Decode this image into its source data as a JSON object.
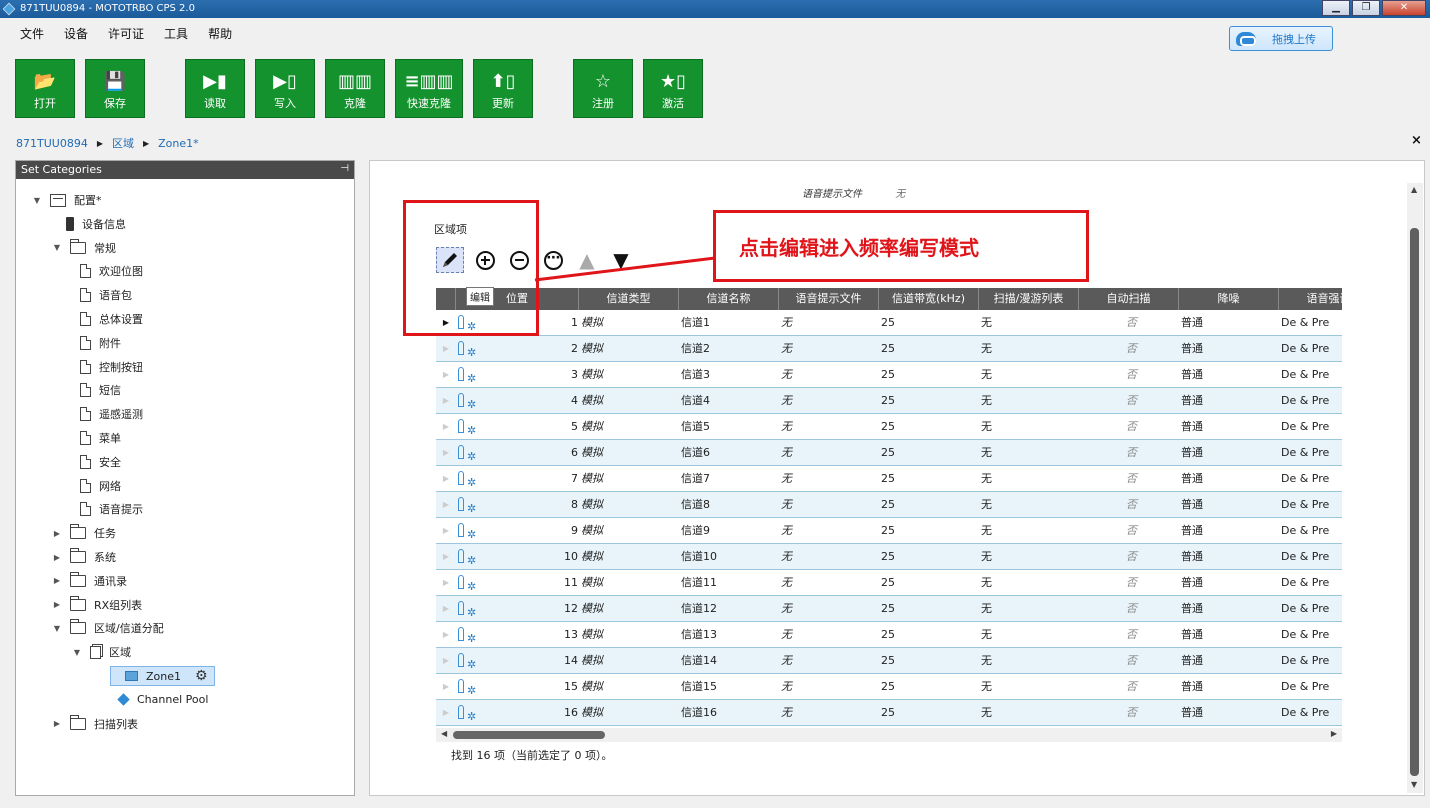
{
  "window": {
    "title": "871TUU0894 - MOTOTRBO CPS 2.0",
    "min": "▁",
    "max": "❐",
    "close": "✕"
  },
  "menu": [
    "文件",
    "设备",
    "许可证",
    "工具",
    "帮助"
  ],
  "upload_label": "拖拽上传",
  "toolbar": [
    {
      "label": "打开",
      "icon": "folder-open-icon",
      "glyph": "📂"
    },
    {
      "label": "保存",
      "icon": "save-icon",
      "glyph": "💾"
    },
    {
      "label": "读取",
      "icon": "read-icon",
      "glyph": "▶▮"
    },
    {
      "label": "写入",
      "icon": "write-icon",
      "glyph": "▶▯"
    },
    {
      "label": "克隆",
      "icon": "clone-icon",
      "glyph": "▥▥"
    },
    {
      "label": "快速克隆",
      "icon": "fast-clone-icon",
      "glyph": "≡▥▥"
    },
    {
      "label": "更新",
      "icon": "update-icon",
      "glyph": "⬆▯"
    },
    {
      "label": "注册",
      "icon": "star-icon",
      "glyph": "☆"
    },
    {
      "label": "激活",
      "icon": "activate-icon",
      "glyph": "★▯"
    }
  ],
  "breadcrumb": [
    "871TUU0894",
    "区域",
    "Zone1*"
  ],
  "breadcrumb_sep": "▶",
  "breadcrumb_close": "×",
  "left_panel": {
    "title": "Set Categories",
    "pin": "⊣",
    "tree": [
      {
        "label": "配置*",
        "expander": "▼",
        "icon": "box"
      },
      {
        "label": "设备信息",
        "expander": "",
        "icon": "radio"
      },
      {
        "label": "常规",
        "expander": "▼",
        "icon": "folder"
      },
      {
        "label": "欢迎位图",
        "expander": "",
        "icon": "doc"
      },
      {
        "label": "语音包",
        "expander": "",
        "icon": "doc"
      },
      {
        "label": "总体设置",
        "expander": "",
        "icon": "doc"
      },
      {
        "label": "附件",
        "expander": "",
        "icon": "doc"
      },
      {
        "label": "控制按钮",
        "expander": "",
        "icon": "doc"
      },
      {
        "label": "短信",
        "expander": "",
        "icon": "doc"
      },
      {
        "label": "遥感遥测",
        "expander": "",
        "icon": "doc"
      },
      {
        "label": "菜单",
        "expander": "",
        "icon": "doc"
      },
      {
        "label": "安全",
        "expander": "",
        "icon": "doc"
      },
      {
        "label": "网络",
        "expander": "",
        "icon": "doc"
      },
      {
        "label": "语音提示",
        "expander": "",
        "icon": "doc"
      },
      {
        "label": "任务",
        "expander": "▶",
        "icon": "folder"
      },
      {
        "label": "系统",
        "expander": "▶",
        "icon": "folder"
      },
      {
        "label": "通讯录",
        "expander": "▶",
        "icon": "folder"
      },
      {
        "label": "RX组列表",
        "expander": "▶",
        "icon": "folder"
      },
      {
        "label": "区域/信道分配",
        "expander": "▼",
        "icon": "folder"
      },
      {
        "label": "区域",
        "expander": "▼",
        "icon": "docs"
      },
      {
        "label": "Zone1",
        "expander": "",
        "icon": "blue-folder",
        "gear": "⚙"
      },
      {
        "label": "Channel Pool",
        "expander": "",
        "icon": "cube"
      },
      {
        "label": "扫描列表",
        "expander": "▶",
        "icon": "folder"
      }
    ]
  },
  "voice_file": {
    "label": "语音提示文件",
    "value": "无"
  },
  "zone_items_label": "区域项",
  "zone_tools": {
    "up": "▲",
    "down": "▼"
  },
  "tooltip": "编辑",
  "callout": "点击编辑进入频率编写模式",
  "columns": [
    "位置",
    "信道类型",
    "信道名称",
    "语音提示文件",
    "信道带宽(kHz)",
    "扫描/漫游列表",
    "自动扫描",
    "降噪",
    "语音强调"
  ],
  "rows": [
    {
      "pos": "1",
      "type": "模拟",
      "name": "信道1",
      "voice": "无",
      "bw": "25",
      "scan": "无",
      "auto": "否",
      "noise": "普通",
      "emph": "De & Pre"
    },
    {
      "pos": "2",
      "type": "模拟",
      "name": "信道2",
      "voice": "无",
      "bw": "25",
      "scan": "无",
      "auto": "否",
      "noise": "普通",
      "emph": "De & Pre"
    },
    {
      "pos": "3",
      "type": "模拟",
      "name": "信道3",
      "voice": "无",
      "bw": "25",
      "scan": "无",
      "auto": "否",
      "noise": "普通",
      "emph": "De & Pre"
    },
    {
      "pos": "4",
      "type": "模拟",
      "name": "信道4",
      "voice": "无",
      "bw": "25",
      "scan": "无",
      "auto": "否",
      "noise": "普通",
      "emph": "De & Pre"
    },
    {
      "pos": "5",
      "type": "模拟",
      "name": "信道5",
      "voice": "无",
      "bw": "25",
      "scan": "无",
      "auto": "否",
      "noise": "普通",
      "emph": "De & Pre"
    },
    {
      "pos": "6",
      "type": "模拟",
      "name": "信道6",
      "voice": "无",
      "bw": "25",
      "scan": "无",
      "auto": "否",
      "noise": "普通",
      "emph": "De & Pre"
    },
    {
      "pos": "7",
      "type": "模拟",
      "name": "信道7",
      "voice": "无",
      "bw": "25",
      "scan": "无",
      "auto": "否",
      "noise": "普通",
      "emph": "De & Pre"
    },
    {
      "pos": "8",
      "type": "模拟",
      "name": "信道8",
      "voice": "无",
      "bw": "25",
      "scan": "无",
      "auto": "否",
      "noise": "普通",
      "emph": "De & Pre"
    },
    {
      "pos": "9",
      "type": "模拟",
      "name": "信道9",
      "voice": "无",
      "bw": "25",
      "scan": "无",
      "auto": "否",
      "noise": "普通",
      "emph": "De & Pre"
    },
    {
      "pos": "10",
      "type": "模拟",
      "name": "信道10",
      "voice": "无",
      "bw": "25",
      "scan": "无",
      "auto": "否",
      "noise": "普通",
      "emph": "De & Pre"
    },
    {
      "pos": "11",
      "type": "模拟",
      "name": "信道11",
      "voice": "无",
      "bw": "25",
      "scan": "无",
      "auto": "否",
      "noise": "普通",
      "emph": "De & Pre"
    },
    {
      "pos": "12",
      "type": "模拟",
      "name": "信道12",
      "voice": "无",
      "bw": "25",
      "scan": "无",
      "auto": "否",
      "noise": "普通",
      "emph": "De & Pre"
    },
    {
      "pos": "13",
      "type": "模拟",
      "name": "信道13",
      "voice": "无",
      "bw": "25",
      "scan": "无",
      "auto": "否",
      "noise": "普通",
      "emph": "De & Pre"
    },
    {
      "pos": "14",
      "type": "模拟",
      "name": "信道14",
      "voice": "无",
      "bw": "25",
      "scan": "无",
      "auto": "否",
      "noise": "普通",
      "emph": "De & Pre"
    },
    {
      "pos": "15",
      "type": "模拟",
      "name": "信道15",
      "voice": "无",
      "bw": "25",
      "scan": "无",
      "auto": "否",
      "noise": "普通",
      "emph": "De & Pre"
    },
    {
      "pos": "16",
      "type": "模拟",
      "name": "信道16",
      "voice": "无",
      "bw": "25",
      "scan": "无",
      "auto": "否",
      "noise": "普通",
      "emph": "De & Pre"
    }
  ],
  "row_marker": "▶",
  "row_icon_glyph": "✲",
  "status": "找到 16 项（当前选定了 0 项）。",
  "colors": {
    "toolbar_green": "#14922e",
    "callout_red": "#e0151a",
    "link_blue": "#1f6bb5",
    "row_alt": "#e8f4fa"
  }
}
